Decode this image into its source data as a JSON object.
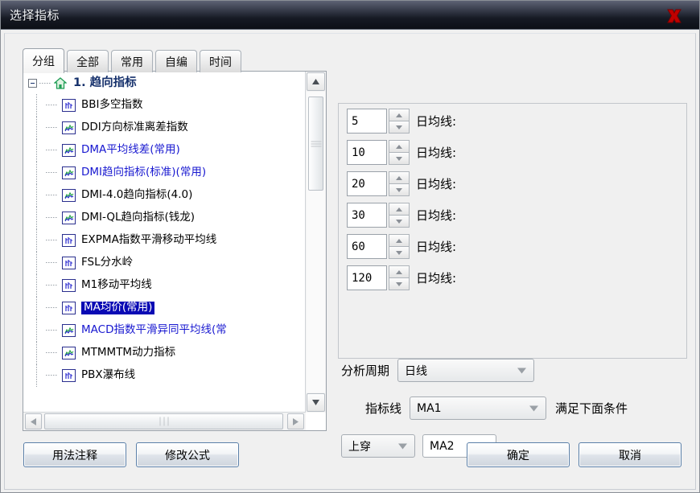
{
  "window": {
    "title": "选择指标",
    "close_icon": "close-x-icon"
  },
  "tabs": [
    {
      "label": "分组",
      "active": true
    },
    {
      "label": "全部",
      "active": false
    },
    {
      "label": "常用",
      "active": false
    },
    {
      "label": "自编",
      "active": false
    },
    {
      "label": "时间",
      "active": false
    }
  ],
  "tree": {
    "root": {
      "label": "1. 趋向指标",
      "icon": "home-icon",
      "expanded": true
    },
    "items": [
      {
        "label": "BBI多空指数",
        "icon": "bar-chart-icon",
        "color": "black",
        "selected": false
      },
      {
        "label": "DDI方向标准离差指数",
        "icon": "line-chart-icon",
        "color": "black",
        "selected": false
      },
      {
        "label": "DMA平均线差(常用)",
        "icon": "line-chart-icon",
        "color": "blue",
        "selected": false
      },
      {
        "label": "DMI趋向指标(标准)(常用)",
        "icon": "line-chart-icon",
        "color": "blue",
        "selected": false
      },
      {
        "label": "DMI-4.0趋向指标(4.0)",
        "icon": "line-chart-icon",
        "color": "black",
        "selected": false
      },
      {
        "label": "DMI-QL趋向指标(钱龙)",
        "icon": "line-chart-icon",
        "color": "black",
        "selected": false
      },
      {
        "label": "EXPMA指数平滑移动平均线",
        "icon": "bar-chart-icon",
        "color": "black",
        "selected": false
      },
      {
        "label": "FSL分水岭",
        "icon": "bar-chart-icon",
        "color": "black",
        "selected": false
      },
      {
        "label": "M1移动平均线",
        "icon": "bar-chart-icon",
        "color": "black",
        "selected": false
      },
      {
        "label": "MA均价(常用)",
        "icon": "bar-chart-icon",
        "color": "black",
        "selected": true
      },
      {
        "label": "MACD指数平滑异同平均线(常",
        "icon": "line-chart-icon",
        "color": "blue",
        "selected": false
      },
      {
        "label": "MTMMTM动力指标",
        "icon": "line-chart-icon",
        "color": "black",
        "selected": false
      },
      {
        "label": "PBX瀑布线",
        "icon": "bar-chart-icon",
        "color": "black",
        "selected": false
      }
    ]
  },
  "params": [
    {
      "value": "5",
      "label": "日均线:"
    },
    {
      "value": "10",
      "label": "日均线:"
    },
    {
      "value": "20",
      "label": "日均线:"
    },
    {
      "value": "30",
      "label": "日均线:"
    },
    {
      "value": "60",
      "label": "日均线:"
    },
    {
      "value": "120",
      "label": "日均线:"
    }
  ],
  "controls": {
    "period_label": "分析周期",
    "period_value": "日线",
    "line_label": "指标线",
    "line_value": "MA1",
    "condition_note": "满足下面条件",
    "cross_value": "上穿",
    "target_value": "MA2"
  },
  "footer": {
    "usage_note": "用法注释",
    "edit_formula": "修改公式",
    "ok": "确定",
    "cancel": "取消"
  },
  "colors": {
    "accent_blue": "#1818d0",
    "selection_blue": "#0a0ab4",
    "root_blue": "#15306b",
    "close_red": "#c00000"
  }
}
